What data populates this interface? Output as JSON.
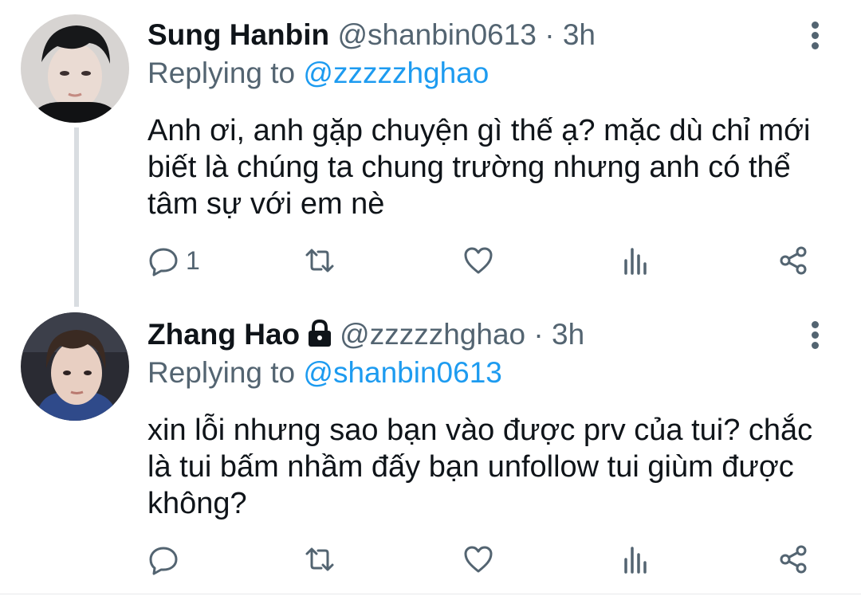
{
  "tweets": [
    {
      "author_name": "Sung Hanbin",
      "handle": "@shanbin0613",
      "separator": "·",
      "time": "3h",
      "reply_prefix": "Replying to",
      "reply_to": "@zzzzzhghao",
      "text": "Anh ơi, anh gặp chuyện gì thế ạ? mặc dù chỉ mới biết là chúng ta chung trường nhưng anh có thể tâm sự với em nè",
      "reply_count": "1",
      "retweet_count": "",
      "like_count": "",
      "protected": false
    },
    {
      "author_name": "Zhang Hao",
      "handle": "@zzzzzhghao",
      "separator": "·",
      "time": "3h",
      "reply_prefix": "Replying to",
      "reply_to": "@shanbin0613",
      "text": "xin lỗi nhưng sao bạn vào được prv của tui? chắc là tui bấm nhầm đấy bạn unfollow tui giùm được không?",
      "reply_count": "",
      "retweet_count": "",
      "like_count": "",
      "protected": true
    }
  ],
  "icons": {
    "reply": "reply-icon",
    "retweet": "retweet-icon",
    "like": "like-icon",
    "analytics": "analytics-icon",
    "share": "share-icon",
    "more": "more-options-icon",
    "lock": "lock-icon"
  },
  "colors": {
    "text": "#0f1419",
    "secondary": "#536471",
    "accent": "#1d9bf0",
    "thread_line": "#d9dde1"
  }
}
